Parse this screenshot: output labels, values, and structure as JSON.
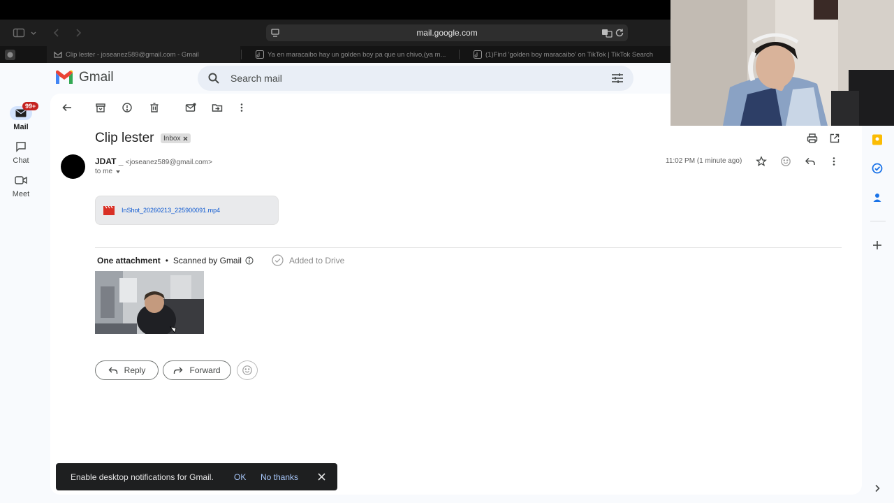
{
  "browser": {
    "url": "mail.google.com",
    "tabs": [
      {
        "title": "Clip lester - joseanez589@gmail.com - Gmail",
        "active": true
      },
      {
        "title": "Ya en maracaibo hay un golden boy pa que un chivo,(ya m...",
        "active": false
      },
      {
        "title": "(1)Find 'golden boy maracaibo' on TikTok | TikTok Search",
        "active": false
      }
    ]
  },
  "gmail": {
    "logo_text": "Gmail",
    "search_placeholder": "Search mail",
    "nav": [
      {
        "label": "Mail",
        "badge": "99+",
        "icon": "mail-icon"
      },
      {
        "label": "Chat",
        "icon": "chat-icon"
      },
      {
        "label": "Meet",
        "icon": "meet-icon"
      }
    ]
  },
  "email": {
    "subject": "Clip lester",
    "label_chip": "Inbox",
    "sender_name": "JDAT _",
    "sender_email": "<joseanez589@gmail.com>",
    "to": "to me",
    "time": "11:02 PM (1 minute ago)",
    "attachment_file": "InShot_20260213_225900091.mp4",
    "attachment_count": "One attachment",
    "scanned": "Scanned by Gmail",
    "added_to_drive": "Added to Drive"
  },
  "actions": {
    "reply": "Reply",
    "forward": "Forward"
  },
  "snackbar": {
    "message": "Enable desktop notifications for Gmail.",
    "ok": "OK",
    "no_thanks": "No thanks"
  },
  "colors": {
    "gmail_red": "#ea4335",
    "accent_blue": "#0b57d0",
    "snackbar_bg": "#1e1f20"
  }
}
